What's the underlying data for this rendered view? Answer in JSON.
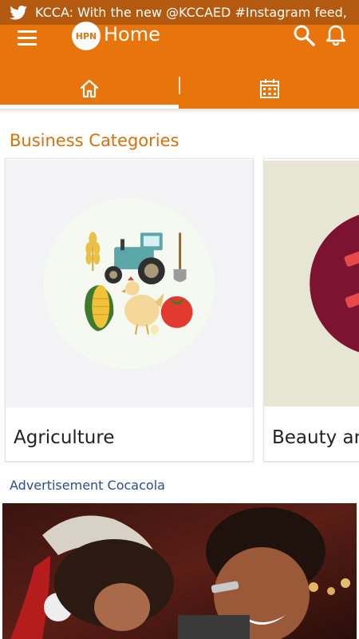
{
  "ticker": {
    "text": "KCCA: With the new @KCCAED #Instagram feed,",
    "icon": "twitter-icon"
  },
  "app_bar": {
    "logo_text": "HPN",
    "title": "Home",
    "icons": [
      "menu-icon",
      "search-icon",
      "bell-icon"
    ],
    "tabs": [
      {
        "icon": "home-icon",
        "selected": true
      },
      {
        "icon": "calendar-icon",
        "selected": false
      }
    ]
  },
  "section": {
    "title": "Business Categories"
  },
  "categories": [
    {
      "label": "Agriculture",
      "image": "agriculture-illustration"
    },
    {
      "label": "Beauty and",
      "image": "beauty-illustration"
    }
  ],
  "advertisement": {
    "title": "Advertisement Cocacola",
    "image": "advertisement-photo"
  },
  "colors": {
    "primary": "#e8740c",
    "status_bar": "#b45a10",
    "section_title": "#d9700b",
    "ad_title": "#2b4d8c"
  }
}
